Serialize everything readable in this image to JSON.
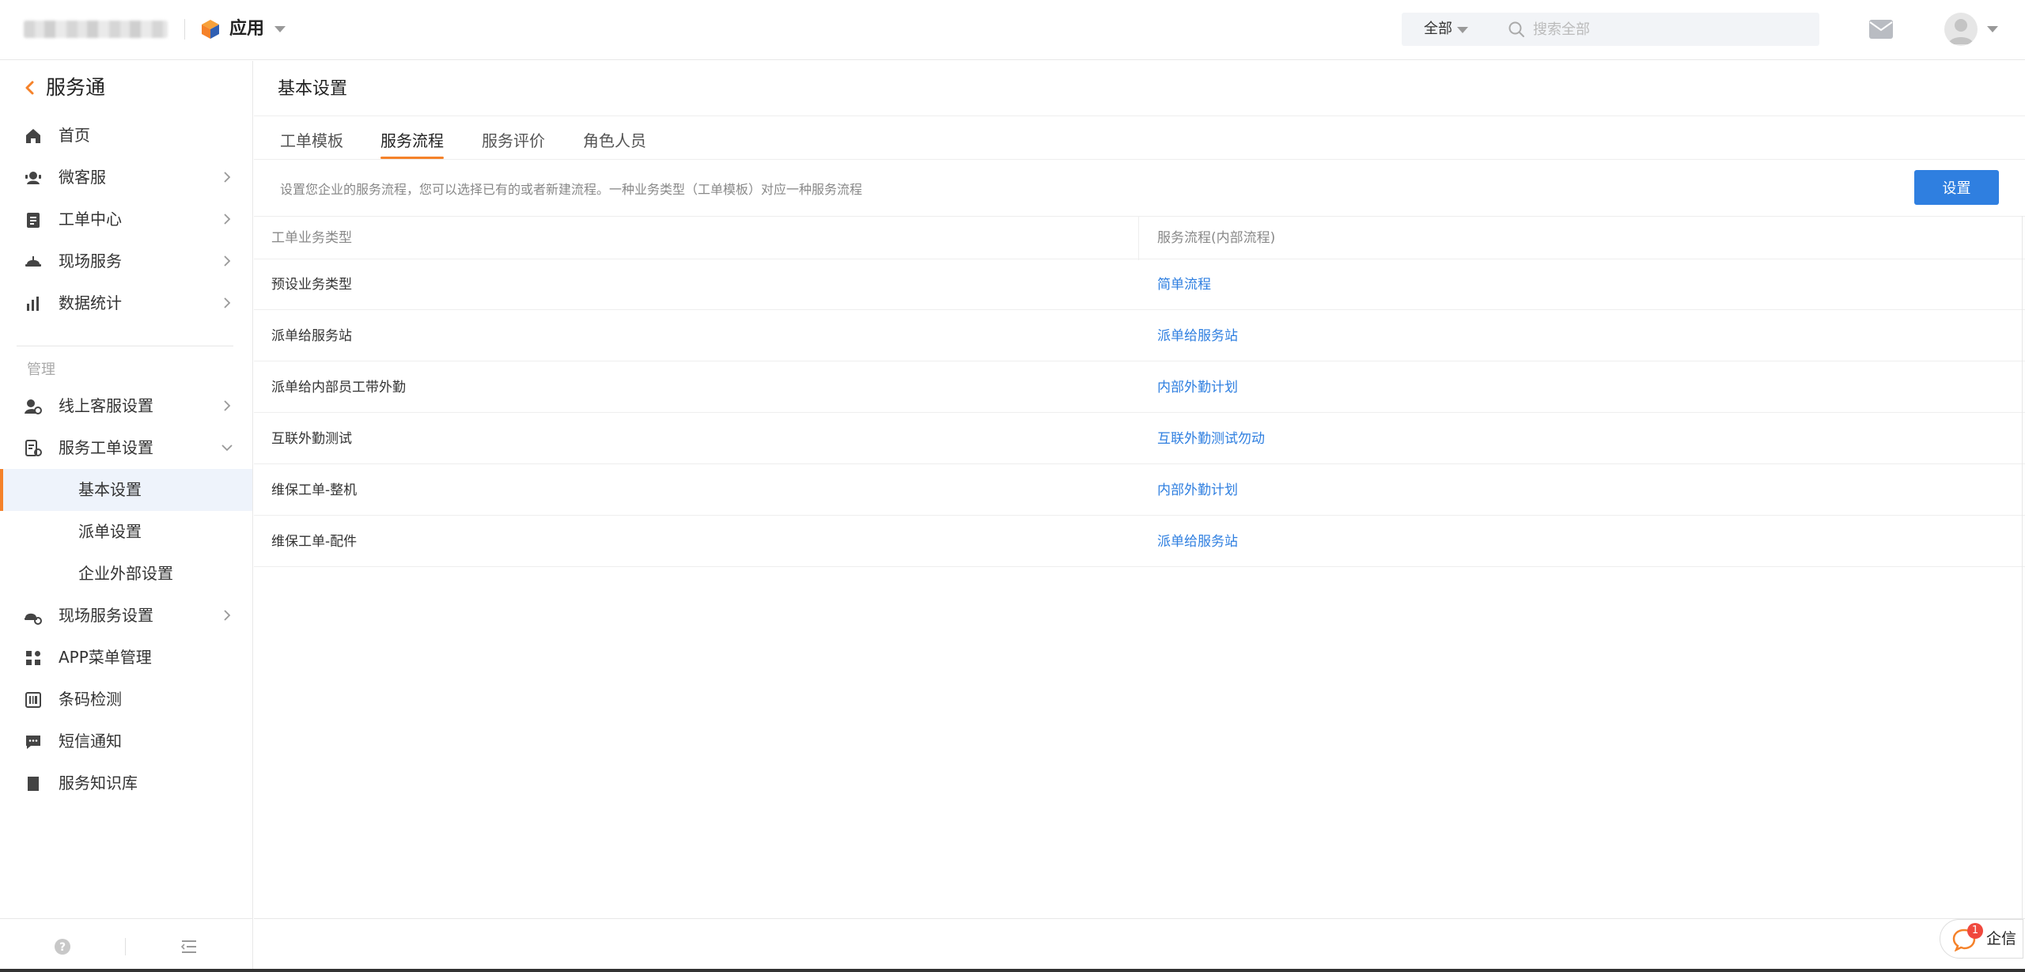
{
  "topbar": {
    "app_label": "应用",
    "search_scope": "全部",
    "search_placeholder": "搜索全部"
  },
  "sidebar": {
    "title": "服务通",
    "items": [
      {
        "label": "首页",
        "icon": "home-icon"
      },
      {
        "label": "微客服",
        "icon": "customer-service-icon"
      },
      {
        "label": "工单中心",
        "icon": "ticket-icon"
      },
      {
        "label": "现场服务",
        "icon": "helmet-icon"
      },
      {
        "label": "数据统计",
        "icon": "bar-chart-icon"
      }
    ],
    "section_label": "管理",
    "manage_items": [
      {
        "label": "线上客服设置",
        "icon": "user-settings-icon"
      },
      {
        "label": "服务工单设置",
        "icon": "ticket-settings-icon"
      },
      {
        "label": "基本设置"
      },
      {
        "label": "派单设置"
      },
      {
        "label": "企业外部设置"
      },
      {
        "label": "现场服务设置",
        "icon": "field-settings-icon"
      },
      {
        "label": "APP菜单管理",
        "icon": "grid-icon"
      },
      {
        "label": "条码检测",
        "icon": "barcode-icon"
      },
      {
        "label": "短信通知",
        "icon": "sms-icon"
      },
      {
        "label": "服务知识库",
        "icon": "book-icon"
      }
    ]
  },
  "main": {
    "page_title": "基本设置",
    "tabs": [
      {
        "label": "工单模板"
      },
      {
        "label": "服务流程"
      },
      {
        "label": "服务评价"
      },
      {
        "label": "角色人员"
      }
    ],
    "description": "设置您企业的服务流程，您可以选择已有的或者新建流程。一种业务类型（工单模板）对应一种服务流程",
    "set_button": "设置",
    "table": {
      "headers": [
        "工单业务类型",
        "服务流程(内部流程)"
      ],
      "rows": [
        {
          "type": "预设业务类型",
          "flow": "简单流程"
        },
        {
          "type": "派单给服务站",
          "flow": "派单给服务站"
        },
        {
          "type": "派单给内部员工带外勤",
          "flow": "内部外勤计划"
        },
        {
          "type": "互联外勤测试",
          "flow": "互联外勤测试勿动"
        },
        {
          "type": "维保工单-整机",
          "flow": "内部外勤计划"
        },
        {
          "type": "维保工单-配件",
          "flow": "派单给服务站"
        }
      ]
    }
  },
  "qixin": {
    "badge": "1",
    "label": "企信"
  },
  "colors": {
    "accent": "#f5822a",
    "primary": "#2f7fe0"
  }
}
